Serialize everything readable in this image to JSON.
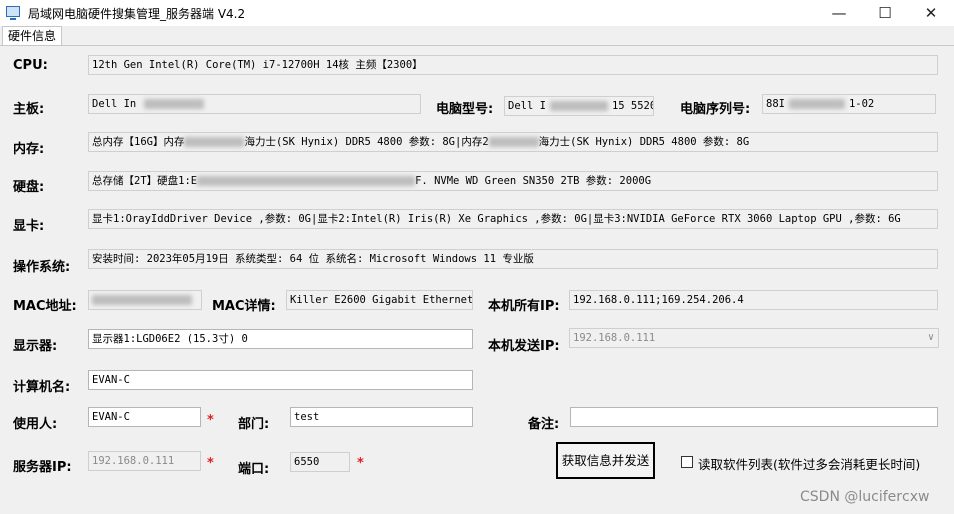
{
  "window": {
    "title": "局域网电脑硬件搜集管理_服务器端 V4.2",
    "minimize_glyph": "—",
    "maximize_glyph": "☐",
    "close_glyph": "✕"
  },
  "tab": {
    "label": "硬件信息"
  },
  "fields": {
    "cpu": {
      "label": "CPU:",
      "value": "12th Gen Intel(R) Core(TM) i7-12700H 14核 主频【2300】"
    },
    "board": {
      "label": "主板:",
      "value_prefix": "Dell In"
    },
    "model": {
      "label": "电脑型号:",
      "value_prefix": "Dell I",
      "value_suffix": "15 5520"
    },
    "serial": {
      "label": "电脑序列号:",
      "value_prefix": "88I",
      "value_suffix": "1-02"
    },
    "memory": {
      "label": "内存:",
      "value_a": "总内存【16G】内存",
      "value_b": "海力士(SK Hynix)  DDR5 4800   参数: 8G|内存2",
      "value_c": "海力士(SK Hynix)  DDR5 4800   参数: 8G"
    },
    "disk": {
      "label": "硬盘:",
      "value_prefix": "总存储【2T】硬盘1:E",
      "value_suffix": "F. NVMe WD Green SN350 2TB 参数: 2000G"
    },
    "gpu": {
      "label": "显卡:",
      "value": "显卡1:OrayIddDriver Device  ,参数: 0G|显卡2:Intel(R) Iris(R) Xe Graphics  ,参数: 0G|显卡3:NVIDIA GeForce RTX 3060 Laptop GPU  ,参数: 6G"
    },
    "os": {
      "label": "操作系统:",
      "value": "安装时间: 2023年05月19日 系统类型: 64 位 系统名: Microsoft Windows 11 专业版"
    },
    "mac": {
      "label": "MAC地址:"
    },
    "mac_detail": {
      "label": "MAC详情:",
      "value": "Killer E2600 Gigabit Ethernet"
    },
    "all_ip": {
      "label": "本机所有IP:",
      "value": "192.168.0.111;169.254.206.4"
    },
    "monitor": {
      "label": "显示器:",
      "value": "显示器1:LGD06E2 (15.3寸) 0"
    },
    "send_ip": {
      "label": "本机发送IP:",
      "value": "192.168.0.111"
    },
    "computer_name": {
      "label": "计算机名:",
      "value": "EVAN-C"
    },
    "user": {
      "label": "使用人:",
      "value": "EVAN-C"
    },
    "department": {
      "label": "部门:",
      "value": "test"
    },
    "remark": {
      "label": "备注:",
      "value": ""
    },
    "server_ip": {
      "label": "服务器IP:",
      "value": "192.168.0.111"
    },
    "port": {
      "label": "端口:",
      "value": "6550"
    }
  },
  "required_mark": "*",
  "actions": {
    "send_button": "获取信息并发送",
    "read_software_label": "读取软件列表(软件过多会消耗更长时间)",
    "read_software_checked": false
  },
  "watermark": "CSDN @luciferсxw",
  "colors": {
    "required": "#e02020",
    "title_bg": "#ffffff",
    "panel_bg": "#f0f0f0"
  }
}
